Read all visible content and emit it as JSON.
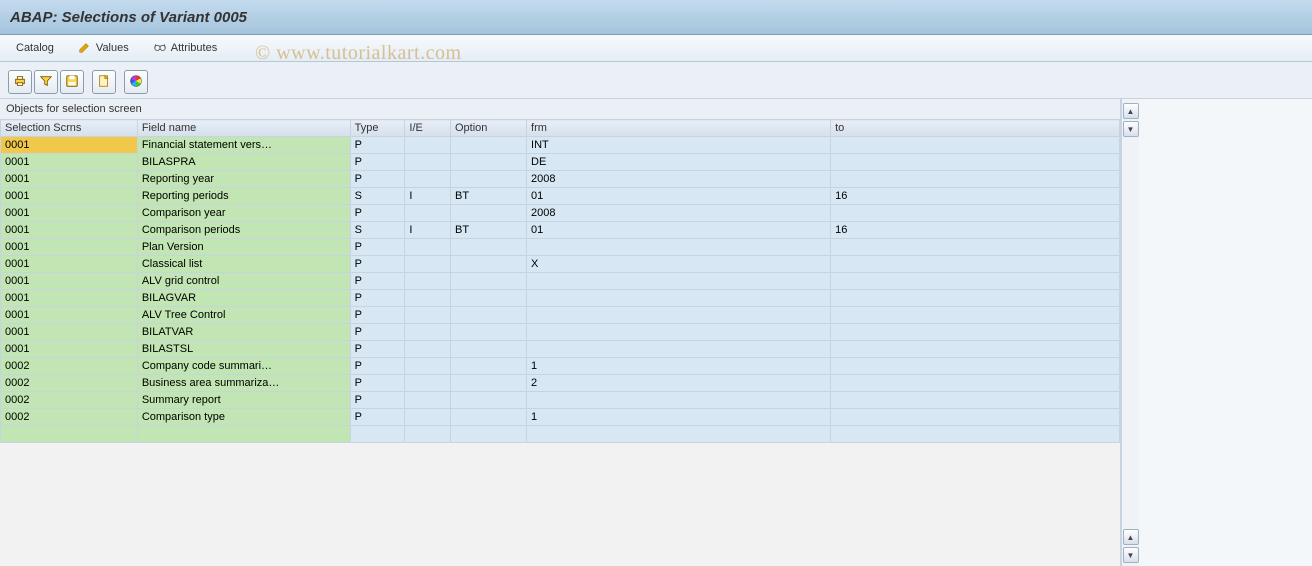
{
  "header": {
    "title": "ABAP: Selections of Variant 0005"
  },
  "menu": {
    "catalog": "Catalog",
    "values": "Values",
    "attributes": "Attributes"
  },
  "watermark": "© www.tutorialkart.com",
  "table": {
    "title": "Objects for selection screen",
    "headers": {
      "scrn": "Selection Scrns",
      "field": "Field name",
      "type": "Type",
      "ie": "I/E",
      "opt": "Option",
      "frm": "frm",
      "to": "to"
    },
    "rows": [
      {
        "scrn": "0001",
        "highlight": true,
        "field": "Financial statement vers…",
        "type": "P",
        "ie": "",
        "opt": "",
        "frm": "INT",
        "to": ""
      },
      {
        "scrn": "0001",
        "field": "BILASPRA",
        "type": "P",
        "ie": "",
        "opt": "",
        "frm": "DE",
        "to": ""
      },
      {
        "scrn": "0001",
        "field": "Reporting year",
        "type": "P",
        "ie": "",
        "opt": "",
        "frm": "2008",
        "to": ""
      },
      {
        "scrn": "0001",
        "field": "Reporting periods",
        "type": "S",
        "ie": "I",
        "opt": "BT",
        "frm": "01",
        "to": "16"
      },
      {
        "scrn": "0001",
        "field": "Comparison year",
        "type": "P",
        "ie": "",
        "opt": "",
        "frm": "2008",
        "to": ""
      },
      {
        "scrn": "0001",
        "field": "Comparison periods",
        "type": "S",
        "ie": "I",
        "opt": "BT",
        "frm": "01",
        "to": "16"
      },
      {
        "scrn": "0001",
        "field": "Plan Version",
        "type": "P",
        "ie": "",
        "opt": "",
        "frm": "",
        "to": ""
      },
      {
        "scrn": "0001",
        "field": "Classical list",
        "type": "P",
        "ie": "",
        "opt": "",
        "frm": "X",
        "to": ""
      },
      {
        "scrn": "0001",
        "field": "ALV grid control",
        "type": "P",
        "ie": "",
        "opt": "",
        "frm": "",
        "to": ""
      },
      {
        "scrn": "0001",
        "field": "BILAGVAR",
        "type": "P",
        "ie": "",
        "opt": "",
        "frm": "",
        "to": ""
      },
      {
        "scrn": "0001",
        "field": "ALV Tree Control",
        "type": "P",
        "ie": "",
        "opt": "",
        "frm": "",
        "to": ""
      },
      {
        "scrn": "0001",
        "field": "BILATVAR",
        "type": "P",
        "ie": "",
        "opt": "",
        "frm": "",
        "to": ""
      },
      {
        "scrn": "0001",
        "field": "BILASTSL",
        "type": "P",
        "ie": "",
        "opt": "",
        "frm": "",
        "to": ""
      },
      {
        "scrn": "0002",
        "field": "Company code summari…",
        "type": "P",
        "ie": "",
        "opt": "",
        "frm": "1",
        "to": ""
      },
      {
        "scrn": "0002",
        "field": "Business area summariza…",
        "type": "P",
        "ie": "",
        "opt": "",
        "frm": "2",
        "to": ""
      },
      {
        "scrn": "0002",
        "field": "Summary report",
        "type": "P",
        "ie": "",
        "opt": "",
        "frm": "",
        "to": ""
      },
      {
        "scrn": "0002",
        "field": "Comparison type",
        "type": "P",
        "ie": "",
        "opt": "",
        "frm": "1",
        "to": ""
      }
    ]
  }
}
